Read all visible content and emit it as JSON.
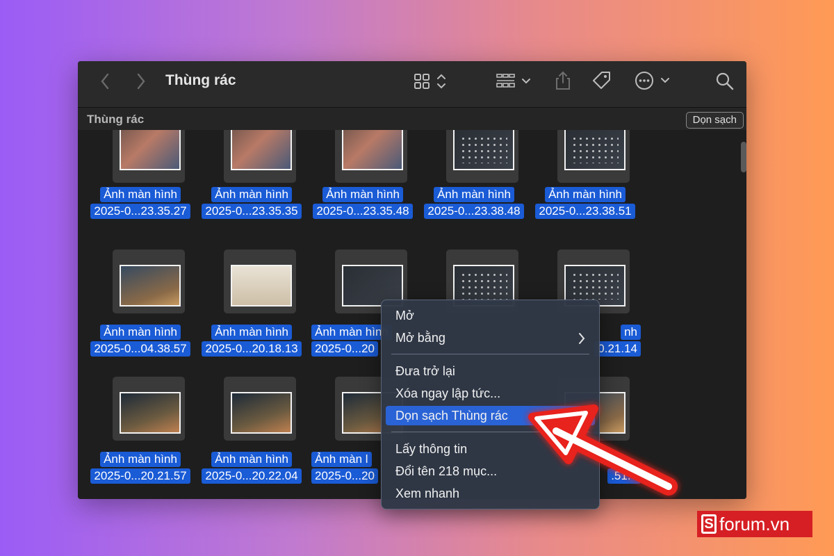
{
  "window": {
    "title": "Thùng rác"
  },
  "pathbar": {
    "label": "Thùng rác",
    "empty_button": "Dọn sạch"
  },
  "files": [
    {
      "line1": "Ảnh màn hình",
      "line2": "2025-0...23.35.27"
    },
    {
      "line1": "Ảnh màn hình",
      "line2": "2025-0...23.35.35"
    },
    {
      "line1": "Ảnh màn hình",
      "line2": "2025-0...23.35.48"
    },
    {
      "line1": "Ảnh màn hình",
      "line2": "2025-0...23.38.48"
    },
    {
      "line1": "Ảnh màn hình",
      "line2": "2025-0...23.38.51"
    },
    {
      "line1": "Ảnh màn hình",
      "line2": "2025-0...04.38.57"
    },
    {
      "line1": "Ảnh màn hình",
      "line2": "2025-0...20.18.13"
    },
    {
      "line1": "Ảnh màn hình",
      "line2": "2025-0...20"
    },
    {
      "line1": "",
      "line2": ""
    },
    {
      "line1": "nh",
      "line2": "0.21.14"
    },
    {
      "line1": "Ảnh màn hình",
      "line2": "2025-0...20.21.57"
    },
    {
      "line1": "Ảnh màn hình",
      "line2": "2025-0...20.22.04"
    },
    {
      "line1": "Ảnh màn l",
      "line2": "2025-0...20"
    },
    {
      "line1": "",
      "line2": ""
    },
    {
      "line1": "",
      "line2": ".51.4"
    }
  ],
  "context_menu": {
    "items": [
      {
        "label": "Mở"
      },
      {
        "label": "Mở bằng",
        "submenu": ">"
      },
      {
        "label": "Đưa trở lại"
      },
      {
        "label": "Xóa ngay lập tức..."
      },
      {
        "label": "Dọn sạch Thùng rác",
        "highlighted": true
      },
      {
        "label": "Lấy thông tin"
      },
      {
        "label": "Đổi tên 218 mục..."
      },
      {
        "label": "Xem nhanh"
      }
    ]
  },
  "watermark": {
    "text": "forum.vn",
    "logo_letter": "S"
  },
  "colors": {
    "selection": "#1a5bd6",
    "menu_highlight": "#2a63d6",
    "arrow": "#e8231c"
  }
}
